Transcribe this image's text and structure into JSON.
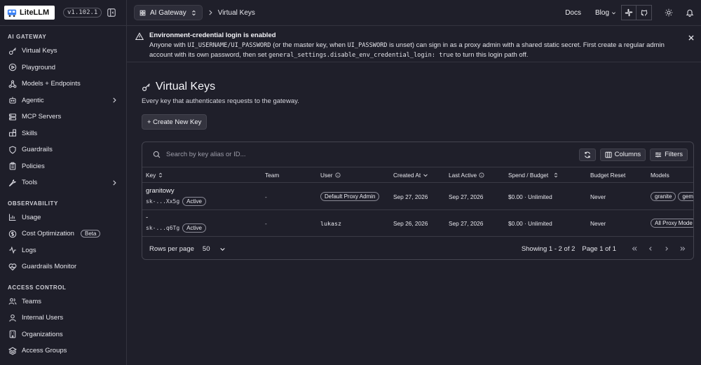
{
  "app": {
    "logo_text": "LiteLLM",
    "version": "v1.102.1"
  },
  "sidebar": {
    "sections": [
      {
        "title": "AI GATEWAY",
        "items": [
          {
            "label": "Virtual Keys",
            "icon": "key-icon"
          },
          {
            "label": "Playground",
            "icon": "play-icon"
          },
          {
            "label": "Models + Endpoints",
            "icon": "network-icon"
          },
          {
            "label": "Agentic",
            "icon": "bot-icon",
            "expandable": true
          },
          {
            "label": "MCP Servers",
            "icon": "server-icon"
          },
          {
            "label": "Skills",
            "icon": "blocks-icon"
          },
          {
            "label": "Guardrails",
            "icon": "shield-icon"
          },
          {
            "label": "Policies",
            "icon": "clipboard-icon"
          },
          {
            "label": "Tools",
            "icon": "wrench-icon",
            "expandable": true
          }
        ]
      },
      {
        "title": "OBSERVABILITY",
        "items": [
          {
            "label": "Usage",
            "icon": "bar-chart-icon"
          },
          {
            "label": "Cost Optimization",
            "icon": "dollar-icon",
            "badge": "Beta"
          },
          {
            "label": "Logs",
            "icon": "activity-icon"
          },
          {
            "label": "Guardrails Monitor",
            "icon": "heart-pulse-icon"
          }
        ]
      },
      {
        "title": "ACCESS CONTROL",
        "items": [
          {
            "label": "Teams",
            "icon": "users-icon"
          },
          {
            "label": "Internal Users",
            "icon": "user-icon"
          },
          {
            "label": "Organizations",
            "icon": "building-icon"
          },
          {
            "label": "Access Groups",
            "icon": "layers-icon"
          }
        ]
      }
    ]
  },
  "topbar": {
    "gateway_label": "AI Gateway",
    "breadcrumb_current": "Virtual Keys",
    "docs_label": "Docs",
    "blog_label": "Blog"
  },
  "banner": {
    "title": "Environment-credential login is enabled",
    "text_parts": [
      "Anyone with ",
      "UI_USERNAME",
      "/",
      "UI_PASSWORD",
      " (or the master key, when ",
      "UI_PASSWORD",
      " is unset) can sign in as a proxy admin with a shared static secret. First create a regular admin account with its own password, then set ",
      "general_settings.disable_env_credential_login: true",
      " to turn this login path off."
    ]
  },
  "page": {
    "title": "Virtual Keys",
    "description": "Every key that authenticates requests to the gateway.",
    "create_button": "+ Create New Key"
  },
  "table": {
    "search_placeholder": "Search by key alias or ID...",
    "columns_button": "Columns",
    "filters_button": "Filters",
    "headers": {
      "key": "Key",
      "team": "Team",
      "user": "User",
      "created": "Created At",
      "last_active": "Last Active",
      "spend": "Spend / Budget",
      "reset": "Budget Reset",
      "models": "Models"
    },
    "rows": [
      {
        "alias": "granitowy",
        "token": "sk-...Xx5g",
        "status": "Active",
        "team": "-",
        "user": "Default Proxy Admin",
        "created": "Sep 27, 2026",
        "last_active": "Sep 27, 2026",
        "spend": "$0.00 · Unlimited",
        "reset": "Never",
        "models": [
          "granite",
          "gem"
        ]
      },
      {
        "alias": "-",
        "token": "sk-...q6Tg",
        "status": "Active",
        "team": "-",
        "user": "lukasz",
        "created": "Sep 26, 2026",
        "last_active": "Sep 27, 2026",
        "spend": "$0.00 · Unlimited",
        "reset": "Never",
        "models": [
          "All Proxy Mode"
        ]
      }
    ],
    "footer": {
      "rows_per_page_label": "Rows per page",
      "rows_per_page_value": "50",
      "showing": "Showing 1 - 2 of 2",
      "page": "Page 1 of 1"
    }
  }
}
